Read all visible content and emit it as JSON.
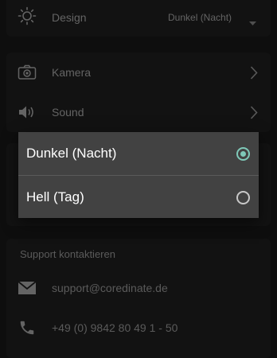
{
  "design": {
    "label": "Design",
    "value": "Dunkel (Nacht)",
    "icon": "sun-icon"
  },
  "media": {
    "camera_label": "Kamera",
    "camera_icon": "camera-icon",
    "sound_label": "Sound",
    "sound_icon": "speaker-icon"
  },
  "dialog": {
    "options": [
      {
        "label": "Dunkel (Nacht)",
        "selected": true
      },
      {
        "label": "Hell (Tag)",
        "selected": false
      }
    ],
    "accent_color": "#7fc8b8"
  },
  "support": {
    "header": "Support kontaktieren",
    "email": "support@coredinate.de",
    "email_icon": "mail-icon",
    "phone": "+49 (0) 9842 80 49 1 - 50",
    "phone_icon": "phone-icon"
  }
}
